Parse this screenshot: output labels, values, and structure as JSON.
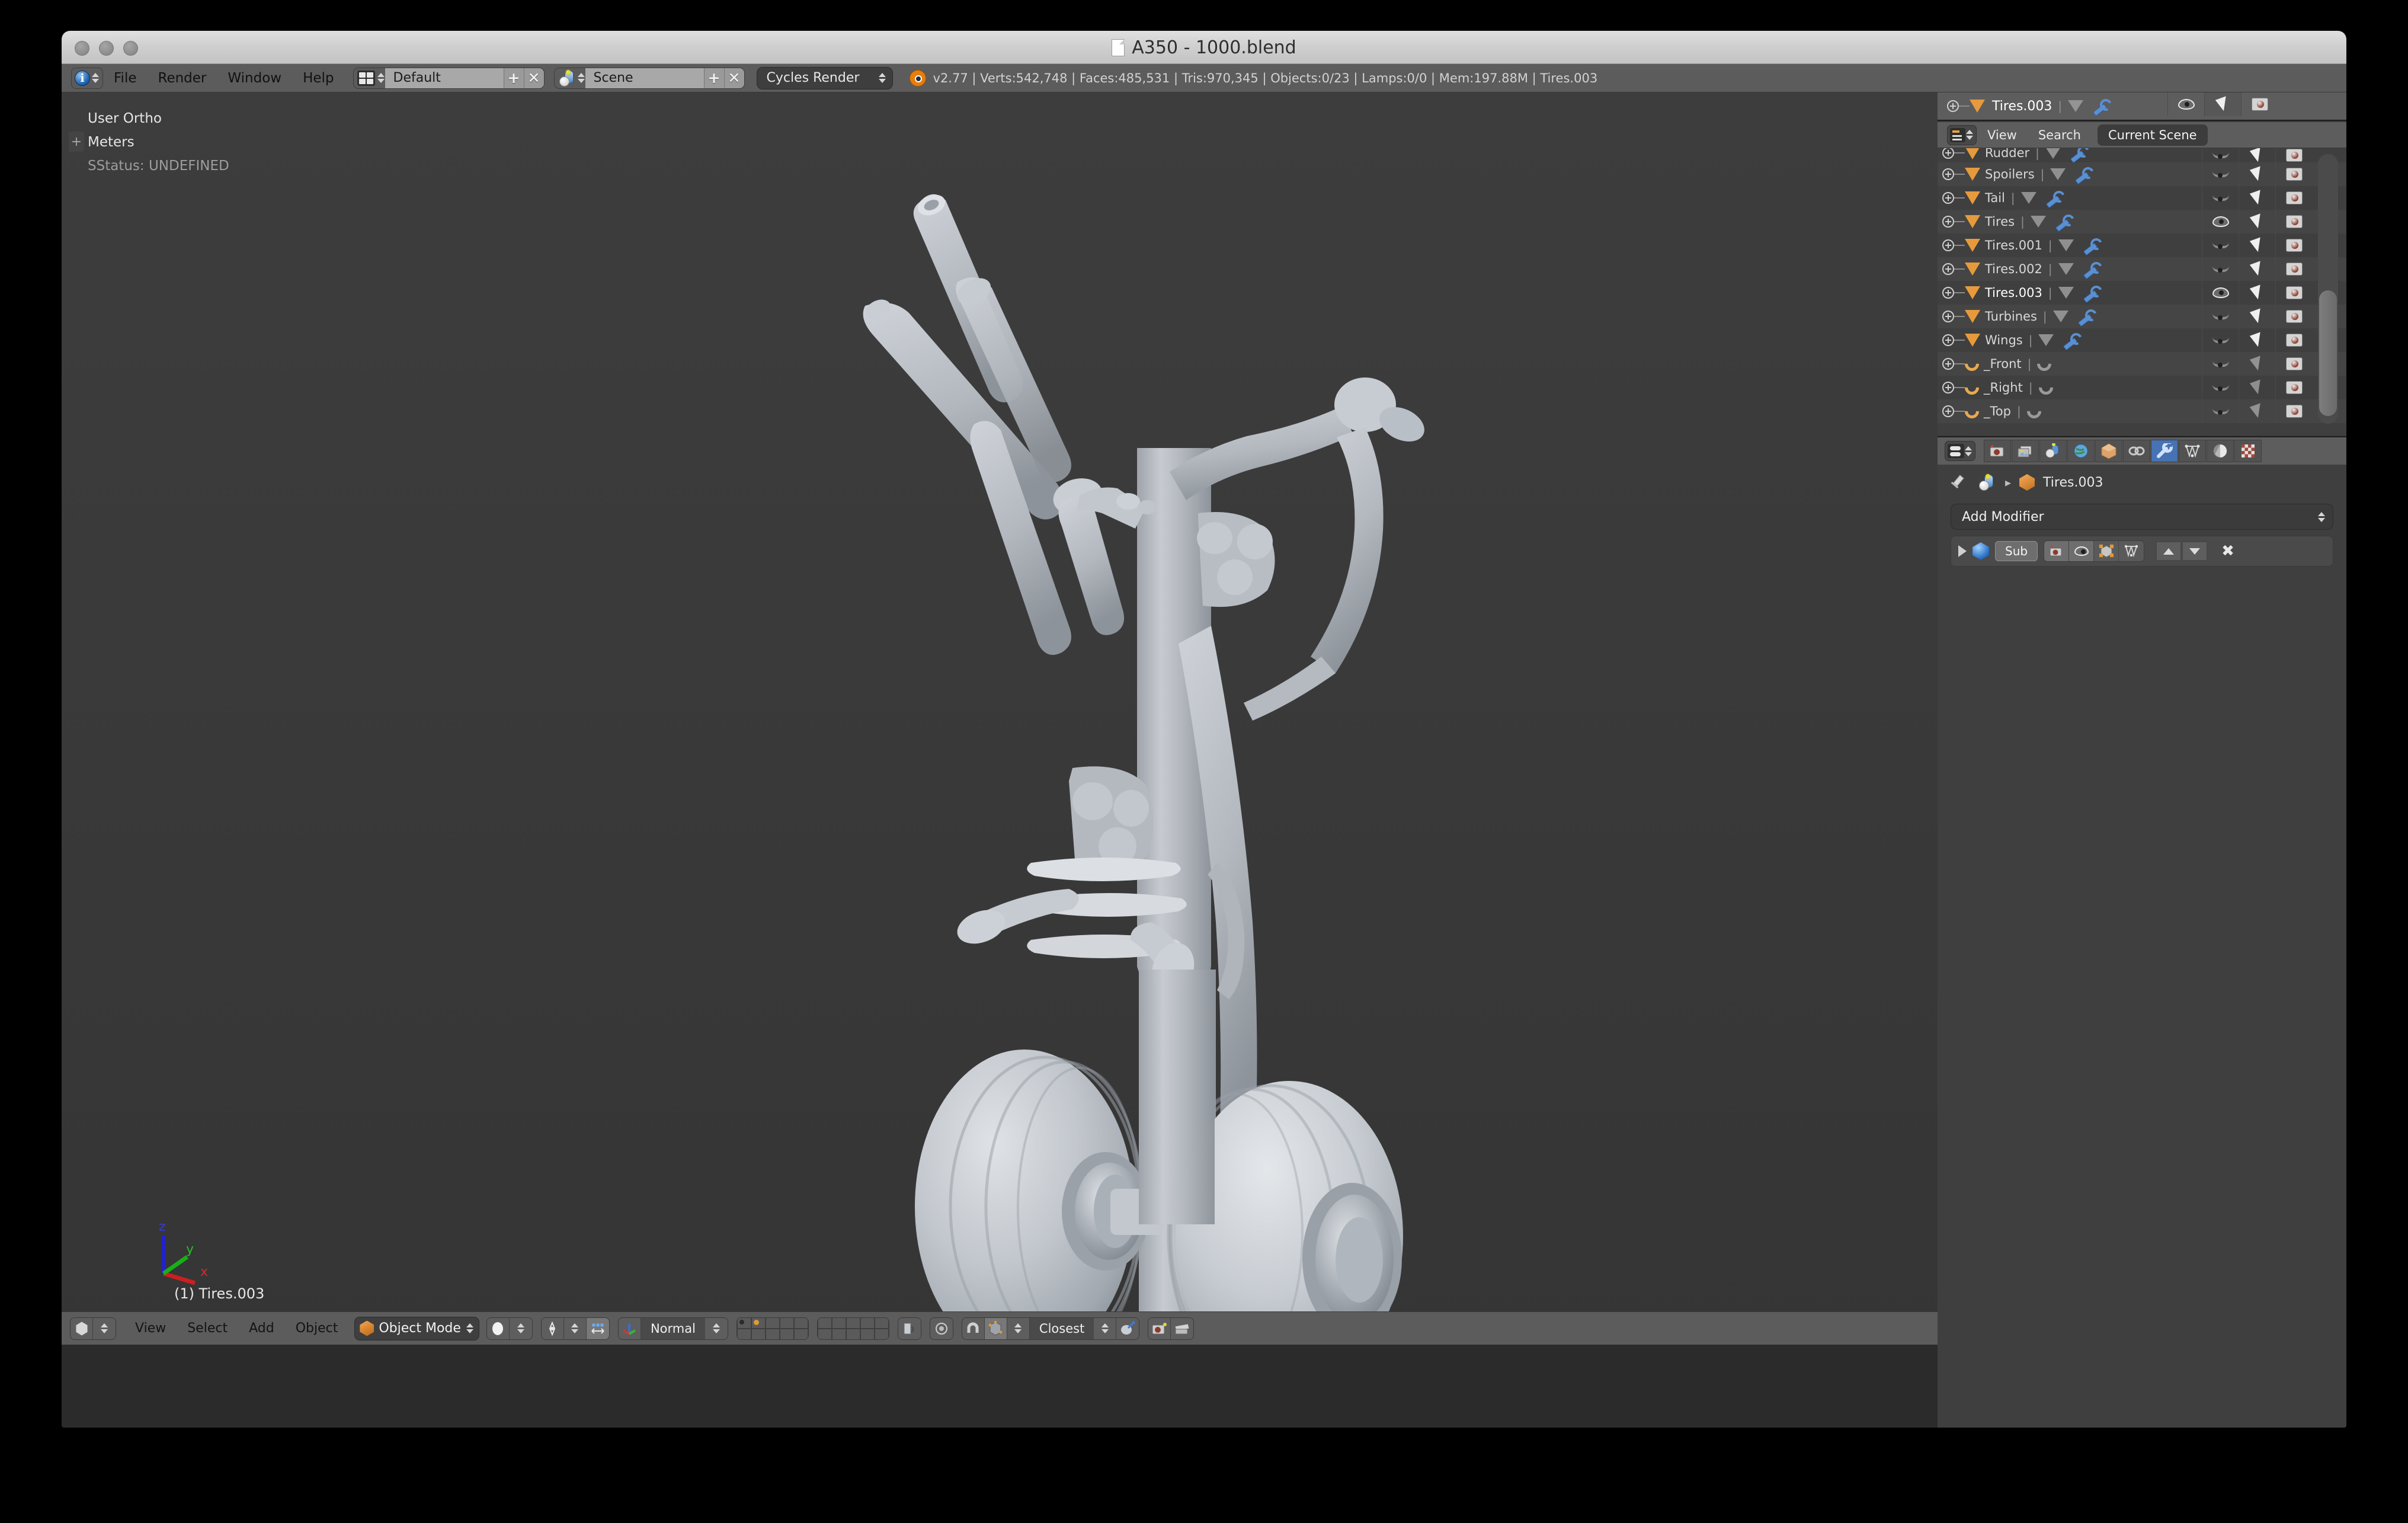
{
  "window": {
    "title": "A350 - 1000.blend",
    "doc_icon": "document-icon"
  },
  "topbar": {
    "editor_icon": "info-editor-icon",
    "menus": [
      "File",
      "Render",
      "Window",
      "Help"
    ],
    "screen_layout": {
      "icon": "screen-layout-icon",
      "value": "Default",
      "add_label": "+",
      "delete_label": "✕"
    },
    "scene": {
      "icon": "scene-icon",
      "value": "Scene",
      "add_label": "+",
      "delete_label": "✕"
    },
    "render_engine": "Cycles Render",
    "stats": {
      "logo": "blender-logo-icon",
      "version": "v2.77",
      "verts": "Verts:542,748",
      "faces": "Faces:485,531",
      "tris": "Tris:970,345",
      "objects": "Objects:0/23",
      "lamps": "Lamps:0/0",
      "mem": "Mem:197.88M",
      "active_object": "Tires.003",
      "full": "v2.77 | Verts:542,748 | Faces:485,531 | Tris:970,345 | Objects:0/23 | Lamps:0/0 | Mem:197.88M | Tires.003"
    }
  },
  "viewport": {
    "view_name": "User Ortho",
    "unit": "Meters",
    "status": "SStatus: UNDEFINED",
    "active_object_label": "(1) Tires.003",
    "axis_labels": {
      "x": "x",
      "y": "y",
      "z": "z"
    },
    "axis_colors": {
      "x": "#cc1f1f",
      "y": "#18b018",
      "z": "#2222cc"
    },
    "background_color": "#3a3a3a",
    "model_color": "#b8bdc4",
    "origin_dot_color": "#d08b2b"
  },
  "viewport_footer": {
    "editor_icon": "3d-view-icon",
    "menus": [
      "View",
      "Select",
      "Add",
      "Object"
    ],
    "mode": {
      "icon": "object-mode-cube-icon",
      "value": "Object Mode"
    },
    "shading": {
      "icon": "solid-shading-icon"
    },
    "pivot": {
      "icon": "pivot-median-point-icon"
    },
    "manipulator": {
      "icon": "manipulator-icon"
    },
    "transform_orientation": "Normal",
    "layers_icon": "scene-layers-grid",
    "lock_icon": "lock-scene-icon",
    "proportional_icon": "proportional-edit-icon",
    "snap_icon": "magnet-snap-icon",
    "snap_element": {
      "icon": "snap-element-vertex-icon",
      "value": "Closest"
    },
    "snap_target": "Closest",
    "opengl_render_icon": "opengl-render-image-icon",
    "opengl_anim_icon": "opengl-render-animation-icon"
  },
  "outliner": {
    "path_row": {
      "plus_icon": "expand-plus-icon",
      "object_icon": "mesh-triangle-icon",
      "name": "Tires.003",
      "data_icon": "mesh-data-icon",
      "modifier_icon": "wrench-icon",
      "restrict_view_icon": "eye-open-icon",
      "restrict_select_icon": "cursor-arrow-icon",
      "restrict_render_icon": "camera-icon"
    },
    "header": {
      "display_mode_icon": "outliner-display-mode-icon",
      "menus": [
        "View",
        "Search"
      ],
      "scene_filter": "Current Scene"
    },
    "rows": [
      {
        "name": "Rudder",
        "type": "mesh",
        "visible": false,
        "alt": false,
        "selected": false,
        "partial": true
      },
      {
        "name": "Spoilers",
        "type": "mesh",
        "visible": false,
        "alt": true,
        "selected": false,
        "partial": false
      },
      {
        "name": "Tail",
        "type": "mesh",
        "visible": false,
        "alt": false,
        "selected": false,
        "partial": false
      },
      {
        "name": "Tires",
        "type": "mesh",
        "visible": true,
        "alt": true,
        "selected": false,
        "partial": false
      },
      {
        "name": "Tires.001",
        "type": "mesh",
        "visible": false,
        "alt": false,
        "selected": false,
        "partial": false
      },
      {
        "name": "Tires.002",
        "type": "mesh",
        "visible": false,
        "alt": true,
        "selected": false,
        "partial": false
      },
      {
        "name": "Tires.003",
        "type": "mesh",
        "visible": true,
        "alt": false,
        "selected": true,
        "partial": false
      },
      {
        "name": "Turbines",
        "type": "mesh",
        "visible": false,
        "alt": true,
        "selected": false,
        "partial": false
      },
      {
        "name": "Wings",
        "type": "mesh",
        "visible": false,
        "alt": false,
        "selected": false,
        "partial": false
      },
      {
        "name": "_Front",
        "type": "curve",
        "visible": false,
        "alt": true,
        "selected": false,
        "partial": false
      },
      {
        "name": "_Right",
        "type": "curve",
        "visible": false,
        "alt": false,
        "selected": false,
        "partial": false
      },
      {
        "name": "_Top",
        "type": "curve",
        "visible": false,
        "alt": true,
        "selected": false,
        "partial": false
      }
    ]
  },
  "properties": {
    "editor_icon": "properties-editor-icon",
    "tabs": [
      {
        "name": "render-tab",
        "icon": "camera-back-icon",
        "active": false
      },
      {
        "name": "render-layers-tab",
        "icon": "images-icon",
        "active": false
      },
      {
        "name": "scene-tab",
        "icon": "scene-icon",
        "active": false
      },
      {
        "name": "world-tab",
        "icon": "globe-icon",
        "active": false
      },
      {
        "name": "object-tab",
        "icon": "object-cube-icon",
        "active": false
      },
      {
        "name": "constraints-tab",
        "icon": "chain-link-icon",
        "active": false
      },
      {
        "name": "modifiers-tab",
        "icon": "wrench-icon",
        "active": true
      },
      {
        "name": "data-tab",
        "icon": "mesh-data-icon",
        "active": false
      },
      {
        "name": "material-tab",
        "icon": "material-ball-icon",
        "active": false
      },
      {
        "name": "texture-tab",
        "icon": "checker-texture-icon",
        "active": false
      }
    ],
    "breadcrumb": {
      "pin_icon": "pin-icon",
      "scene_icon": "scene-icon",
      "chevron": "▸",
      "object_icon": "object-cube-icon",
      "object_name": "Tires.003"
    },
    "add_modifier_label": "Add Modifier",
    "modifier": {
      "expand_icon": "expand-triangle-icon",
      "type_icon": "subsurf-modifier-icon",
      "name": "Sub",
      "toggles": [
        {
          "name": "render-toggle-icon",
          "on": true
        },
        {
          "name": "realtime-eye-toggle-icon",
          "on": true
        },
        {
          "name": "edit-mode-toggle-icon",
          "on": false
        },
        {
          "name": "on-cage-toggle-icon",
          "on": false
        }
      ],
      "move_up_icon": "move-up-icon",
      "move_down_icon": "move-down-icon",
      "delete_icon": "delete-x-icon"
    }
  }
}
